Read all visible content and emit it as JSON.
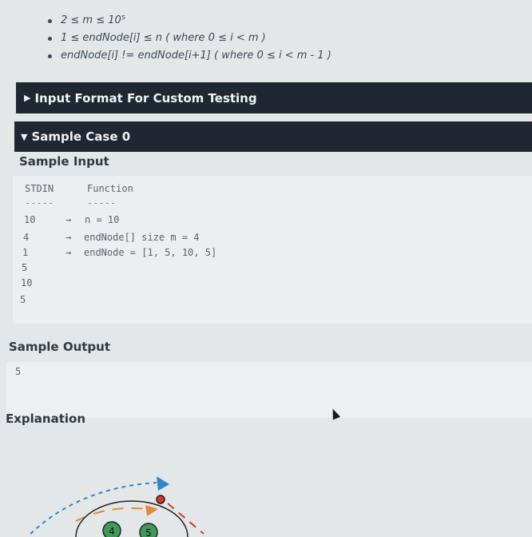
{
  "constraints": [
    "2 ≤ m ≤ 10⁵",
    "1 ≤ endNode[i] ≤ n ( where  0 ≤ i < m )",
    "endNode[i] != endNode[i+1] ( where  0 ≤ i <  m - 1  )"
  ],
  "sections": {
    "custom_testing": "Input Format For Custom Testing",
    "sample_case": "Sample Case 0"
  },
  "sample_input": {
    "title": "Sample Input",
    "stdin_header": "STDIN",
    "function_header": "Function",
    "dashes_left": "-----",
    "dashes_right": "-----",
    "rows": [
      {
        "stdin": "10",
        "arrow": "→",
        "func": "n = 10"
      },
      {
        "stdin": "4",
        "arrow": "→",
        "func": "endNode[] size m = 4"
      },
      {
        "stdin": "1",
        "arrow": "→",
        "func": "endNode = [1, 5, 10, 5]"
      },
      {
        "stdin": "5",
        "arrow": "",
        "func": ""
      },
      {
        "stdin": "10",
        "arrow": "",
        "func": ""
      },
      {
        "stdin": "5",
        "arrow": "",
        "func": ""
      }
    ]
  },
  "sample_output": {
    "title": "Sample Output",
    "value": "5"
  },
  "explanation": {
    "title": "Explanation",
    "node_labels": [
      "4",
      "5"
    ]
  },
  "colors": {
    "header_bar": "#1f2733",
    "arc_blue": "#2f86c9",
    "arc_orange": "#e08a3c",
    "arc_red": "#d9342b",
    "node_green": "#3f9a5a"
  }
}
